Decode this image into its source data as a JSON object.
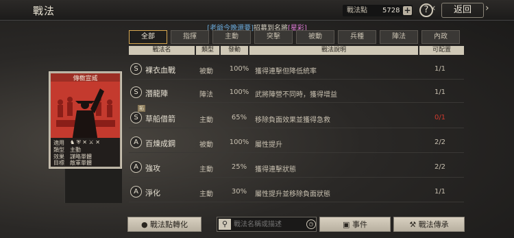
{
  "header": {
    "title": "戰法",
    "points_label": "戰法點",
    "points_value": "5728",
    "plus": "+",
    "help": "?",
    "back_label": "返回"
  },
  "recruit_banner": {
    "part1": "[老爺今晚還要]",
    "part2": "招募到名將",
    "part3": "[星彩]"
  },
  "tabs": [
    "全部",
    "指揮",
    "主動",
    "突擊",
    "被動",
    "兵種",
    "陣法",
    "內政"
  ],
  "active_tab": "全部",
  "columns": [
    "戰法名",
    "類型",
    "發動",
    "戰法說明",
    "可配置"
  ],
  "rows": [
    {
      "badge": "S",
      "name": "裸衣血戰",
      "type": "被動",
      "rate": "100%",
      "desc": "獲得連擊但降低統率",
      "conf": "1/1",
      "conf_red": false,
      "tag": ""
    },
    {
      "badge": "S",
      "name": "潛龍陣",
      "type": "陣法",
      "rate": "100%",
      "desc": "武將陣營不同時，獲得增益",
      "conf": "1/1",
      "conf_red": false,
      "tag": ""
    },
    {
      "badge": "S",
      "name": "草船借箭",
      "type": "主動",
      "rate": "65%",
      "desc": "移除負面效果並獲得急救",
      "conf": "0/1",
      "conf_red": true,
      "tag": "拓"
    },
    {
      "badge": "A",
      "name": "百煉成鋼",
      "type": "被動",
      "rate": "100%",
      "desc": "屬性提升",
      "conf": "2/2",
      "conf_red": false,
      "tag": ""
    },
    {
      "badge": "A",
      "name": "強攻",
      "type": "主動",
      "rate": "25%",
      "desc": "獲得連擊狀態",
      "conf": "2/2",
      "conf_red": false,
      "tag": ""
    },
    {
      "badge": "A",
      "name": "淨化",
      "type": "主動",
      "rate": "30%",
      "desc": "屬性提升並移除負面狀態",
      "conf": "1/1",
      "conf_red": false,
      "tag": ""
    }
  ],
  "card": {
    "title": "傳檄宣威",
    "line1_label": "適用",
    "line2_label": "類型",
    "line2_value": "主動",
    "line3_label": "效果",
    "line3_value": "謀略單體",
    "line4_label": "目標",
    "line4_value": "敵軍單體"
  },
  "bottom": {
    "convert_label": "戰法點轉化",
    "search_placeholder": "戰法名稱或描述",
    "event_label": "事件",
    "inherit_label": "戰法傳承"
  }
}
